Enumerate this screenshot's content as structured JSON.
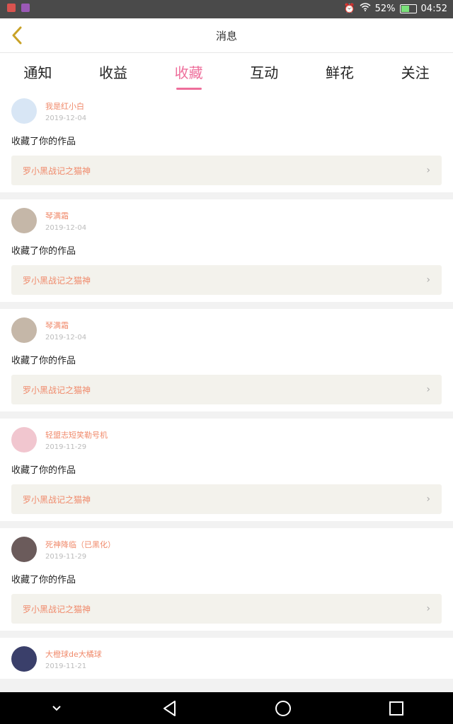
{
  "status_bar": {
    "battery_percent": "52%",
    "time": "04:52",
    "icons": [
      "notification-app-icon",
      "notification-app-icon-purple",
      "alarm-icon",
      "wifi-icon",
      "battery-charging-icon"
    ]
  },
  "header": {
    "title": "消息"
  },
  "tabs": [
    {
      "label": "通知",
      "active": false
    },
    {
      "label": "收益",
      "active": false
    },
    {
      "label": "收藏",
      "active": true
    },
    {
      "label": "互动",
      "active": false
    },
    {
      "label": "鲜花",
      "active": false
    },
    {
      "label": "关注",
      "active": false
    }
  ],
  "items": [
    {
      "user": "我是红小白",
      "date": "2019-12-04",
      "message": "收藏了你的作品",
      "work": "罗小黑战记之猫神",
      "avatar_color": "#d8e6f5"
    },
    {
      "user": "琴满霜",
      "date": "2019-12-04",
      "message": "收藏了你的作品",
      "work": "罗小黑战记之猫神",
      "avatar_color": "#c5b7a8"
    },
    {
      "user": "琴满霜",
      "date": "2019-12-04",
      "message": "收藏了你的作品",
      "work": "罗小黑战记之猫神",
      "avatar_color": "#c5b7a8"
    },
    {
      "user": "轻盟志短笑勒号机",
      "date": "2019-11-29",
      "message": "收藏了你的作品",
      "work": "罗小黑战记之猫神",
      "avatar_color": "#f1c6cf"
    },
    {
      "user": "死神降临（已黑化）",
      "date": "2019-11-29",
      "message": "收藏了你的作品",
      "work": "罗小黑战记之猫神",
      "avatar_color": "#6b5b5b"
    },
    {
      "user": "大橙球de大橘球",
      "date": "2019-11-21",
      "message": "",
      "work": "",
      "avatar_color": "#3a3f6a"
    }
  ],
  "accent_color": "#ee6e9b",
  "nav": [
    "collapse-icon",
    "back-triangle-icon",
    "home-circle-icon",
    "recents-square-icon"
  ]
}
